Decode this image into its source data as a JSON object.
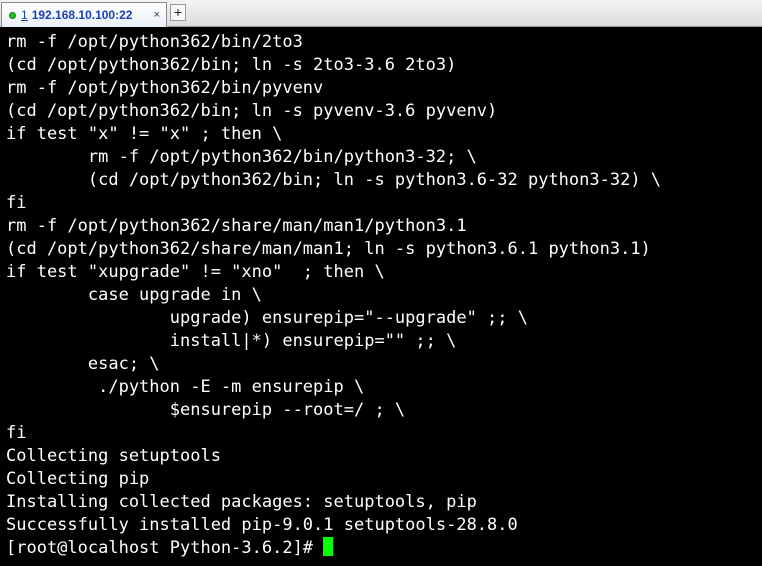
{
  "tab": {
    "number": "1",
    "title": "192.168.10.100:22",
    "close_glyph": "×",
    "new_tab_glyph": "+",
    "status_color": "#22c322"
  },
  "terminal": {
    "foreground": "#ffffff",
    "background": "#000000",
    "cursor_color": "#00ff00",
    "lines": [
      "rm -f /opt/python362/bin/2to3",
      "(cd /opt/python362/bin; ln -s 2to3-3.6 2to3)",
      "rm -f /opt/python362/bin/pyvenv",
      "(cd /opt/python362/bin; ln -s pyvenv-3.6 pyvenv)",
      "if test \"x\" != \"x\" ; then \\",
      "        rm -f /opt/python362/bin/python3-32; \\",
      "        (cd /opt/python362/bin; ln -s python3.6-32 python3-32) \\",
      "fi",
      "rm -f /opt/python362/share/man/man1/python3.1",
      "(cd /opt/python362/share/man/man1; ln -s python3.6.1 python3.1)",
      "if test \"xupgrade\" != \"xno\"  ; then \\",
      "        case upgrade in \\",
      "                upgrade) ensurepip=\"--upgrade\" ;; \\",
      "                install|*) ensurepip=\"\" ;; \\",
      "        esac; \\",
      "         ./python -E -m ensurepip \\",
      "                $ensurepip --root=/ ; \\",
      "fi",
      "Collecting setuptools",
      "Collecting pip",
      "Installing collected packages: setuptools, pip",
      "Successfully installed pip-9.0.1 setuptools-28.8.0"
    ],
    "prompt": "[root@localhost Python-3.6.2]# "
  }
}
